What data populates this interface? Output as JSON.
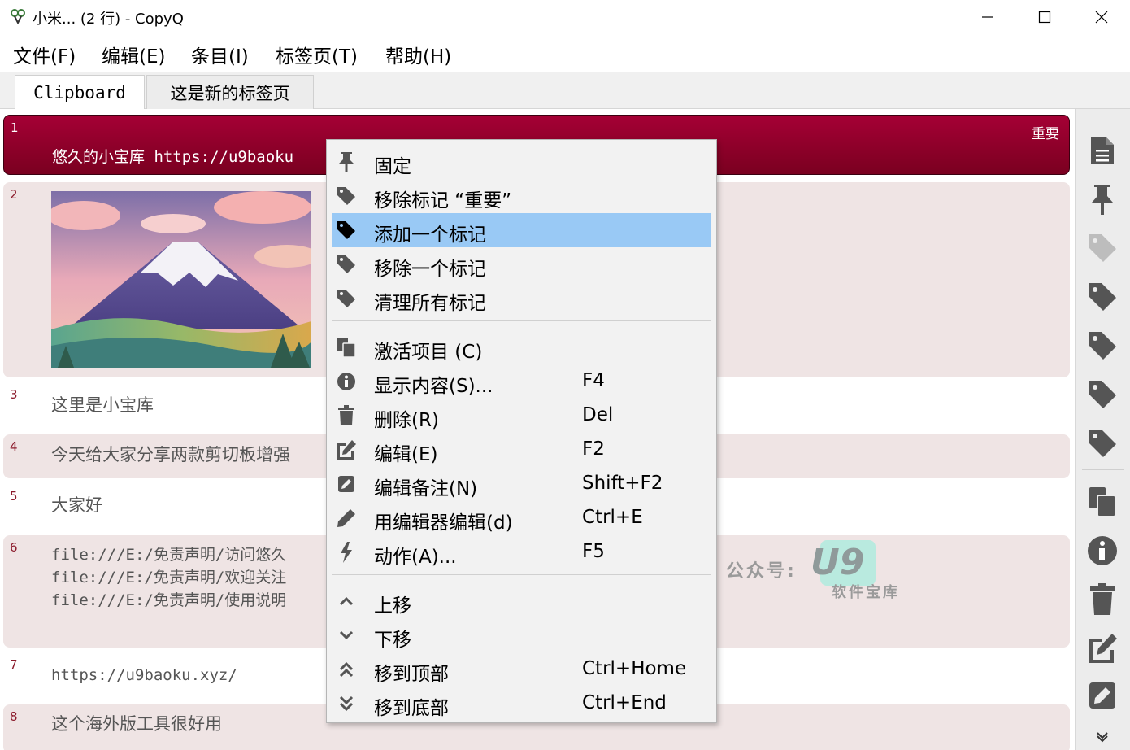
{
  "window": {
    "title": "小米... (2 行) - CopyQ"
  },
  "menu": [
    "文件(F)",
    "编辑(E)",
    "条目(I)",
    "标签页(T)",
    "帮助(H)"
  ],
  "tabs": [
    "Clipboard",
    "这是新的标签页"
  ],
  "items": [
    {
      "num": "1",
      "text": "悠久的小宝库 https://u9baoku",
      "tag": "重要"
    },
    {
      "num": "2",
      "image": "mount-fuji-illustration"
    },
    {
      "num": "3",
      "text": "这里是小宝库"
    },
    {
      "num": "4",
      "text": "今天给大家分享两款剪切板增强"
    },
    {
      "num": "5",
      "text": "大家好"
    },
    {
      "num": "6",
      "text": "file:///E:/免责声明/访问悠久\nfile:///E:/免责声明/欢迎关注\nfile:///E:/免责声明/使用说明"
    },
    {
      "num": "7",
      "text": "https://u9baoku.xyz/"
    },
    {
      "num": "8",
      "text": "这个海外版工具很好用"
    }
  ],
  "context_menu": [
    {
      "label": "固定",
      "shortcut": "",
      "icon": "pin-icon"
    },
    {
      "label": "移除标记 “重要”",
      "shortcut": "",
      "icon": "tag-icon"
    },
    {
      "label": "添加一个标记",
      "shortcut": "",
      "icon": "tag-icon",
      "highlighted": true
    },
    {
      "label": "移除一个标记",
      "shortcut": "",
      "icon": "tag-icon"
    },
    {
      "label": "清理所有标记",
      "shortcut": "",
      "icon": "tag-icon"
    },
    {
      "label": "激活项目 (C)",
      "shortcut": "",
      "icon": "paste-icon"
    },
    {
      "label": "显示内容(S)...",
      "shortcut": "F4",
      "icon": "info-icon"
    },
    {
      "label": "删除(R)",
      "shortcut": "Del",
      "icon": "trash-icon"
    },
    {
      "label": "编辑(E)",
      "shortcut": "F2",
      "icon": "edit-icon"
    },
    {
      "label": "编辑备注(N)",
      "shortcut": "Shift+F2",
      "icon": "note-edit-icon"
    },
    {
      "label": "用编辑器编辑(d)",
      "shortcut": "Ctrl+E",
      "icon": "pencil-icon"
    },
    {
      "label": "动作(A)...",
      "shortcut": "F5",
      "icon": "bolt-icon"
    },
    {
      "label": "上移",
      "shortcut": "",
      "icon": "chevron-up-icon"
    },
    {
      "label": "下移",
      "shortcut": "",
      "icon": "chevron-down-icon"
    },
    {
      "label": "移到顶部",
      "shortcut": "Ctrl+Home",
      "icon": "double-chevron-up-icon"
    },
    {
      "label": "移到底部",
      "shortcut": "Ctrl+End",
      "icon": "double-chevron-down-icon"
    }
  ],
  "watermark": {
    "prefix": "公众号:",
    "logo": "U9",
    "sub": "软件宝库"
  },
  "colors": {
    "selected": "#9b0030",
    "highlight": "#99c9f5",
    "alt_row": "#efe4e4"
  }
}
